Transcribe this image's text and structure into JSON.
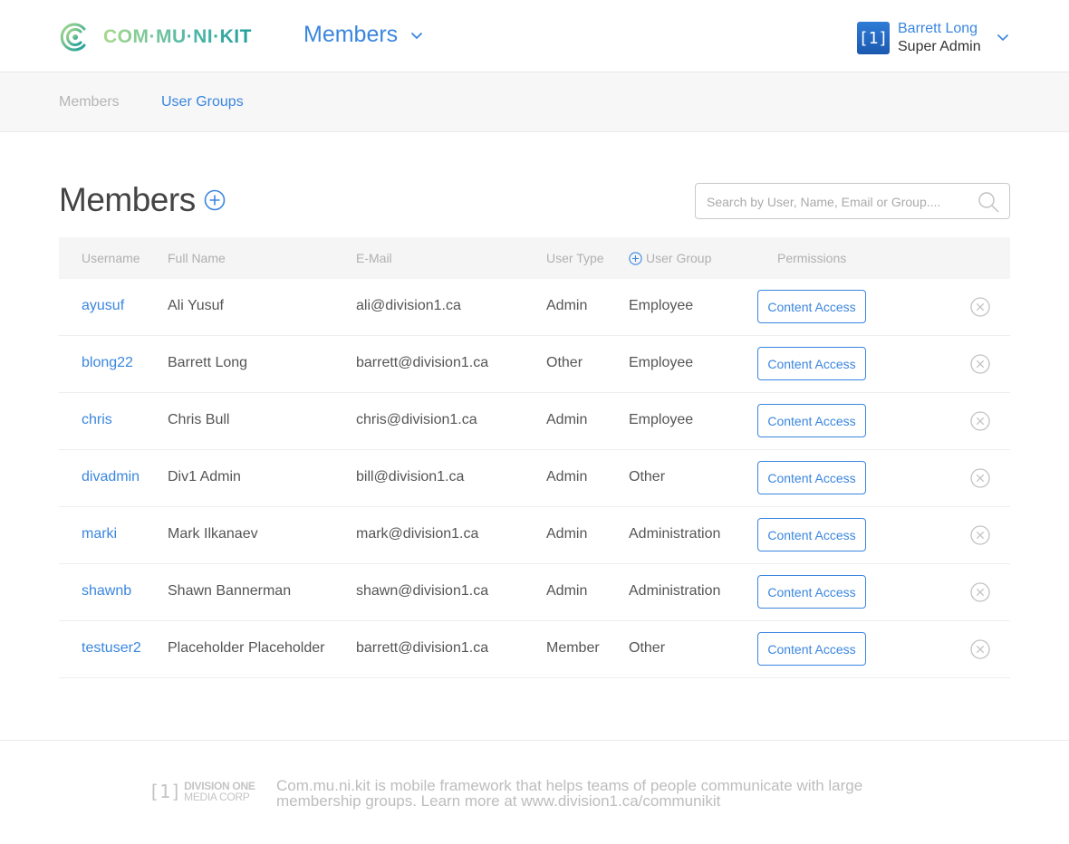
{
  "brand": {
    "logo_text": "COM·MU·NI·KIT",
    "icon": "communikit-logo-icon",
    "accent_color": "#3a86df"
  },
  "header": {
    "section_title": "Members",
    "user": {
      "avatar_text": "[1]",
      "name": "Barrett Long",
      "role": "Super Admin"
    }
  },
  "subnav": {
    "items": [
      {
        "label": "Members"
      },
      {
        "label": "User Groups"
      }
    ]
  },
  "main": {
    "title": "Members",
    "search_placeholder": "Search by User, Name, Email or Group....",
    "table": {
      "columns": {
        "username": "Username",
        "full_name": "Full Name",
        "email": "E-Mail",
        "user_type": "User Type",
        "user_group": "User Group",
        "permissions": "Permissions"
      },
      "rows": [
        {
          "username": "ayusuf",
          "full_name": "Ali Yusuf",
          "email": "ali@division1.ca",
          "user_type": "Admin",
          "user_group": "Employee",
          "permission": "Content Access"
        },
        {
          "username": "blong22",
          "full_name": "Barrett Long",
          "email": "barrett@division1.ca",
          "user_type": "Other",
          "user_group": "Employee",
          "permission": "Content Access"
        },
        {
          "username": "chris",
          "full_name": "Chris Bull",
          "email": "chris@division1.ca",
          "user_type": "Admin",
          "user_group": "Employee",
          "permission": "Content Access"
        },
        {
          "username": "divadmin",
          "full_name": "Div1 Admin",
          "email": "bill@division1.ca",
          "user_type": "Admin",
          "user_group": "Other",
          "permission": "Content Access"
        },
        {
          "username": "marki",
          "full_name": "Mark Ilkanaev",
          "email": "mark@division1.ca",
          "user_type": "Admin",
          "user_group": "Administration",
          "permission": "Content Access"
        },
        {
          "username": "shawnb",
          "full_name": "Shawn Bannerman",
          "email": "shawn@division1.ca",
          "user_type": "Admin",
          "user_group": "Administration",
          "permission": "Content Access"
        },
        {
          "username": "testuser2",
          "full_name": "Placeholder Placeholder",
          "email": "barrett@division1.ca",
          "user_type": "Member",
          "user_group": "Other",
          "permission": "Content Access"
        }
      ]
    }
  },
  "footer": {
    "logo_mark": "[1]",
    "logo_line1": "DIVISION ONE",
    "logo_line2": "MEDIA CORP",
    "text": "Com.mu.ni.kit is mobile framework that helps teams of people communicate with large membership groups. Learn more at www.division1.ca/communikit"
  }
}
